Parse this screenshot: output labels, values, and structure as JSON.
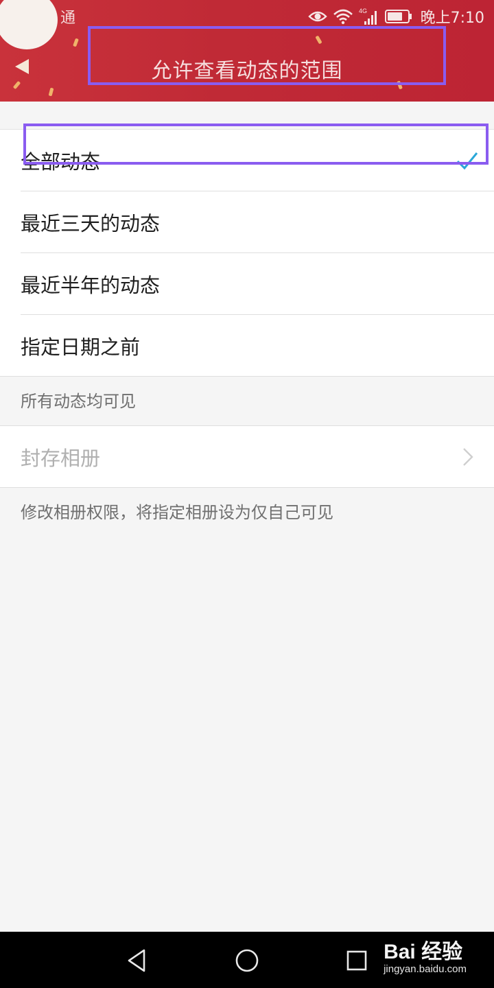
{
  "status_bar": {
    "carrier": "通",
    "network_type": "4G",
    "time": "晚上7:10",
    "icons": [
      "eye-icon",
      "wifi-icon",
      "signal-icon",
      "battery-icon"
    ]
  },
  "header": {
    "title": "允许查看动态的范围",
    "back_icon": "back-arrow-icon",
    "background_color": "#c02a36"
  },
  "options": [
    {
      "label": "全部动态",
      "selected": true
    },
    {
      "label": "最近三天的动态",
      "selected": false
    },
    {
      "label": "最近半年的动态",
      "selected": false
    },
    {
      "label": "指定日期之前",
      "selected": false
    }
  ],
  "visibility_hint": "所有动态均可见",
  "album": {
    "label": "封存相册",
    "hint": "修改相册权限，将指定相册设为仅自己可见"
  },
  "accent_color": "#2aa7d8",
  "highlight_color": "#8a5cf0",
  "watermark": {
    "logo": "Bai 经验",
    "url": "jingyan.baidu.com"
  },
  "nav_bar": {
    "icons": [
      "back-triangle-icon",
      "home-circle-icon",
      "recents-square-icon"
    ]
  }
}
